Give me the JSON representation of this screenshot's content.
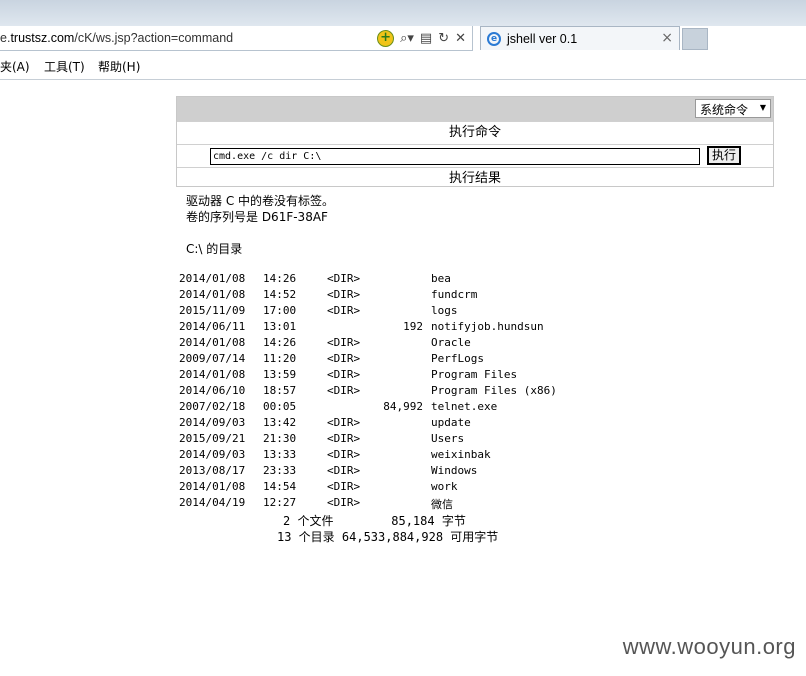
{
  "browser": {
    "address_prefix": "e.",
    "address_domain": "trustsz.com",
    "address_path": "/cK/ws.jsp?action=command",
    "tab_title": "jshell ver 0.1",
    "menu": [
      "夹(A)",
      "工具(T)",
      "帮助(H)"
    ]
  },
  "panel": {
    "select_value": "系统命令",
    "exec_header": "执行命令",
    "cmd_value": "cmd.exe /c dir C:\\",
    "exec_button": "执行",
    "result_header": "执行结果"
  },
  "output": {
    "volume_line": "驱动器 C 中的卷没有标签。",
    "serial_line": "卷的序列号是 D61F-38AF",
    "dir_line": "C:\\ 的目录",
    "entries": [
      {
        "date": "2014/01/08",
        "time": "14:26",
        "type": "<DIR>",
        "size": "",
        "name": "bea"
      },
      {
        "date": "2014/01/08",
        "time": "14:52",
        "type": "<DIR>",
        "size": "",
        "name": "fundcrm"
      },
      {
        "date": "2015/11/09",
        "time": "17:00",
        "type": "<DIR>",
        "size": "",
        "name": "logs"
      },
      {
        "date": "2014/06/11",
        "time": "13:01",
        "type": "",
        "size": "192",
        "name": "notifyjob.hundsun"
      },
      {
        "date": "2014/01/08",
        "time": "14:26",
        "type": "<DIR>",
        "size": "",
        "name": "Oracle"
      },
      {
        "date": "2009/07/14",
        "time": "11:20",
        "type": "<DIR>",
        "size": "",
        "name": "PerfLogs"
      },
      {
        "date": "2014/01/08",
        "time": "13:59",
        "type": "<DIR>",
        "size": "",
        "name": "Program Files"
      },
      {
        "date": "2014/06/10",
        "time": "18:57",
        "type": "<DIR>",
        "size": "",
        "name": "Program Files (x86)"
      },
      {
        "date": "2007/02/18",
        "time": "00:05",
        "type": "",
        "size": "84,992",
        "name": "telnet.exe"
      },
      {
        "date": "2014/09/03",
        "time": "13:42",
        "type": "<DIR>",
        "size": "",
        "name": "update"
      },
      {
        "date": "2015/09/21",
        "time": "21:30",
        "type": "<DIR>",
        "size": "",
        "name": "Users"
      },
      {
        "date": "2014/09/03",
        "time": "13:33",
        "type": "<DIR>",
        "size": "",
        "name": "weixinbak"
      },
      {
        "date": "2013/08/17",
        "time": "23:33",
        "type": "<DIR>",
        "size": "",
        "name": "Windows"
      },
      {
        "date": "2014/01/08",
        "time": "14:54",
        "type": "<DIR>",
        "size": "",
        "name": "work"
      },
      {
        "date": "2014/04/19",
        "time": "12:27",
        "type": "<DIR>",
        "size": "",
        "name": "微信"
      }
    ],
    "files_summary": "2 个文件        85,184 字节",
    "dirs_summary": "13 个目录 64,533,884,928 可用字节"
  },
  "watermark": "www.wooyun.org"
}
